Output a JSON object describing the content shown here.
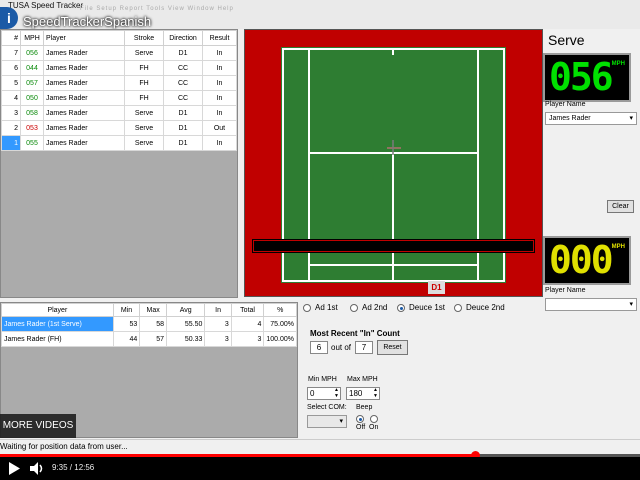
{
  "app": {
    "window_title": "TUSA Speed Tracker",
    "menu_faint": "File   Setup   Report   Tools   View   Window   Help"
  },
  "overlay": {
    "info_icon": "i",
    "video_title": "SpeedTrackerSpanish",
    "more_videos": "MORE VIDEOS"
  },
  "shots_table": {
    "headers": [
      "#",
      "MPH",
      "Player",
      "Stroke",
      "Direction",
      "Result"
    ],
    "rows": [
      {
        "num": "7",
        "mph": "056",
        "player": "James Rader",
        "stroke": "Serve",
        "direction": "D1",
        "result": "In",
        "mph_color": "green"
      },
      {
        "num": "6",
        "mph": "044",
        "player": "James Rader",
        "stroke": "FH",
        "direction": "CC",
        "result": "In",
        "mph_color": "green"
      },
      {
        "num": "5",
        "mph": "057",
        "player": "James Rader",
        "stroke": "FH",
        "direction": "CC",
        "result": "In",
        "mph_color": "green"
      },
      {
        "num": "4",
        "mph": "050",
        "player": "James Rader",
        "stroke": "FH",
        "direction": "CC",
        "result": "In",
        "mph_color": "green"
      },
      {
        "num": "3",
        "mph": "058",
        "player": "James Rader",
        "stroke": "Serve",
        "direction": "D1",
        "result": "In",
        "mph_color": "green"
      },
      {
        "num": "2",
        "mph": "053",
        "player": "James Rader",
        "stroke": "Serve",
        "direction": "D1",
        "result": "Out",
        "mph_color": "red"
      },
      {
        "num": "1",
        "mph": "055",
        "player": "James Rader",
        "stroke": "Serve",
        "direction": "D1",
        "result": "In",
        "mph_color": "green"
      }
    ],
    "selected_row": 6
  },
  "court": {
    "zone_tag": "D1",
    "colors": {
      "surround": "#c00000",
      "court": "#2e7d32",
      "lines": "#ffffff"
    }
  },
  "serve_panel": {
    "title": "Serve",
    "speed1": "056",
    "speed1_unit": "MPH",
    "speed1_color": "#00e000",
    "player_label1": "Player Name",
    "player_value1": "James Rader",
    "clear_label": "Clear",
    "speed2": "000",
    "speed2_unit": "MPH",
    "speed2_color": "#e0e000",
    "player_label2": "Player Name",
    "player_value2": ""
  },
  "stats_table": {
    "headers": [
      "Player",
      "Min",
      "Max",
      "Avg",
      "In",
      "Total",
      "%"
    ],
    "rows": [
      {
        "player": "James Rader (1st Serve)",
        "min": "53",
        "max": "58",
        "avg": "55.50",
        "in": "3",
        "total": "4",
        "pct": "75.00%"
      },
      {
        "player": "James Rader (FH)",
        "min": "44",
        "max": "57",
        "avg": "50.33",
        "in": "3",
        "total": "3",
        "pct": "100.00%"
      }
    ],
    "selected_row": 0
  },
  "serve_mode": {
    "options": [
      "Ad 1st",
      "Ad 2nd",
      "Deuce 1st",
      "Deuce 2nd"
    ],
    "selected": 2
  },
  "recent_in": {
    "label": "Most Recent \"In\" Count",
    "value": "6",
    "of_label": "out of",
    "total": "7",
    "reset_label": "Reset"
  },
  "limits": {
    "min_label": "Min MPH",
    "min_value": "0",
    "max_label": "Max MPH",
    "max_value": "180"
  },
  "com": {
    "label": "Select COM:",
    "value": ""
  },
  "beep": {
    "label": "Beep",
    "off_label": "Off",
    "on_label": "On",
    "selected": "Off"
  },
  "status": {
    "text": "Waiting for position data from user..."
  },
  "player": {
    "time": "9:35 / 12:56",
    "progress": 0.742
  }
}
